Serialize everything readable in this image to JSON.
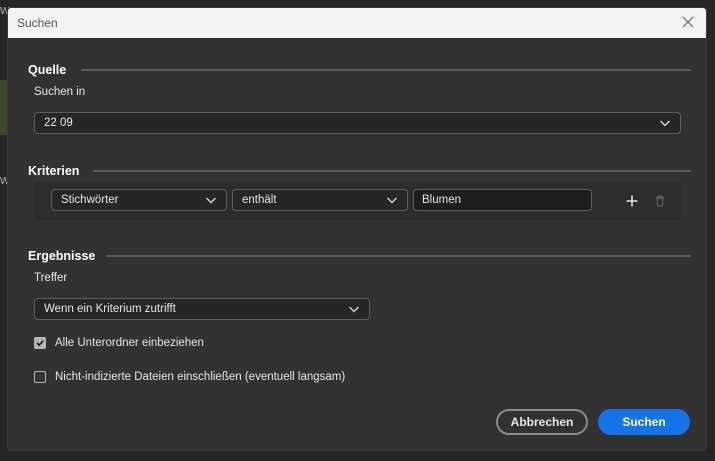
{
  "background": {
    "left_top_letter": "W",
    "left_mid_letter": "W"
  },
  "dialog": {
    "title": "Suchen",
    "source": {
      "heading": "Quelle",
      "search_in_label": "Suchen in",
      "search_in_value": "22 09"
    },
    "criteria": {
      "heading": "Kriterien",
      "field_value": "Stichwörter",
      "operator_value": "enthält",
      "term_value": "Blumen"
    },
    "results": {
      "heading": "Ergebnisse",
      "match_label": "Treffer",
      "match_value": "Wenn ein Kriterium zutrifft",
      "include_subfolders_label": "Alle Unterordner einbeziehen",
      "include_subfolders_checked": true,
      "include_nonindexed_label": "Nicht-indizierte Dateien einschließen (eventuell langsam)",
      "include_nonindexed_checked": false
    },
    "buttons": {
      "cancel": "Abbrechen",
      "search": "Suchen"
    }
  },
  "colors": {
    "accent": "#1473e6",
    "dialog_bg": "#323232",
    "titlebar_bg": "#f3f3f3"
  }
}
